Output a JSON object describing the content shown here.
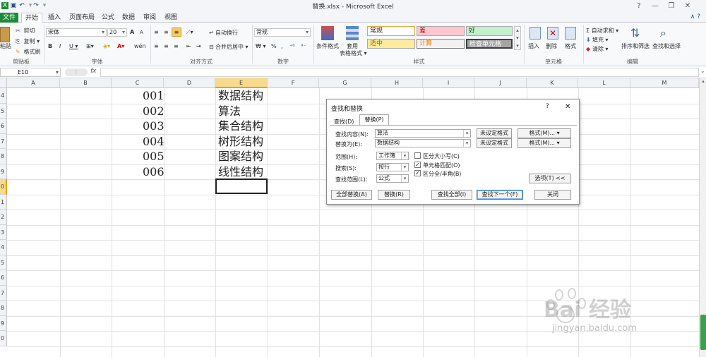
{
  "window": {
    "title": "替换.xlsx - Microsoft Excel",
    "controls": [
      "?",
      "—",
      "❐",
      "✕"
    ]
  },
  "quick_access": [
    "save-icon",
    "undo-icon",
    "redo-icon",
    "customize-icon"
  ],
  "ribbon_tabs": [
    "文件",
    "开始",
    "插入",
    "页面布局",
    "公式",
    "数据",
    "审阅",
    "视图"
  ],
  "ribbon": {
    "clipboard": {
      "paste": "粘贴",
      "cut": "剪切",
      "copy": "复制 ▾",
      "format_painter": "格式刷",
      "label": "剪贴板"
    },
    "font": {
      "name": "宋体",
      "size": "20",
      "label": "字体",
      "grow": "A",
      "shrink": "A",
      "bold": "B",
      "italic": "I",
      "underline": "U ▾",
      "phonetic": "wén"
    },
    "alignment": {
      "wrap": "自动换行",
      "merge": "合并后居中 ▾",
      "label": "对齐方式"
    },
    "number": {
      "format": "常规",
      "label": "数字",
      "percent": "%",
      "comma": ",",
      "currency": "₩ ▾"
    },
    "styles": {
      "conditional": "条件格式",
      "table": "套用",
      "table2": "表格格式 ▾",
      "cells": [
        "常规",
        "差",
        "好",
        "适中",
        "计算",
        "检查单元格"
      ],
      "label": "样式"
    },
    "cells": {
      "insert": "插入",
      "delete": "删除",
      "format": "格式",
      "label": "单元格"
    },
    "editing": {
      "autosum": "Σ 自动求和 ▾",
      "fill": "填充 ▾",
      "clear": "清除 ▾",
      "sort": "排序和筛选",
      "find": "查找和选择",
      "label": "编辑"
    }
  },
  "formula_bar": {
    "name_box": "E10",
    "fx": "fx",
    "value": ""
  },
  "columns": [
    "A",
    "B",
    "C",
    "D",
    "E",
    "F",
    "G",
    "H",
    "I",
    "J",
    "K",
    "L",
    "M"
  ],
  "rows": [
    "4",
    "5",
    "6",
    "7",
    "8",
    "9",
    "0",
    "1",
    "2",
    "3",
    "4",
    "5",
    "6",
    "7",
    "8",
    "9",
    "0"
  ],
  "cells": {
    "c_values": [
      "001",
      "002",
      "003",
      "004",
      "005",
      "006"
    ],
    "e_values": [
      "数据结构",
      "算法",
      "集合结构",
      "树形结构",
      "图案结构",
      "线性结构"
    ]
  },
  "dialog": {
    "title": "查找和替换",
    "help": "?",
    "close": "✕",
    "tabs": [
      "查找(D)",
      "替换(P)"
    ],
    "find_label": "查找内容(N):",
    "find_value": "算法",
    "replace_label": "替换为(E):",
    "replace_value": "数据结构",
    "no_format_1": "未设定格式",
    "no_format_2": "未设定格式",
    "format_1": "格式(M)... ▾",
    "format_2": "格式(M)... ▾",
    "scope_label": "范围(H):",
    "scope_value": "工作簿",
    "search_label": "搜索(S):",
    "search_value": "按行",
    "lookin_label": "查找范围(L):",
    "lookin_value": "公式",
    "opt_case": "区分大小写(C)",
    "opt_cell": "单元格匹配(O)",
    "opt_width": "区分全/半角(B)",
    "options_btn": "选项(T) <<",
    "btn_replace_all": "全部替换(A)",
    "btn_replace": "替换(R)",
    "btn_find_all": "查找全部(I)",
    "btn_find_next": "查找下一个(F)",
    "btn_close": "关闭",
    "checked": [
      "false",
      "true",
      "true"
    ]
  },
  "watermark": {
    "brand": "Bai 经验",
    "url": "jingyan.baidu.com"
  }
}
